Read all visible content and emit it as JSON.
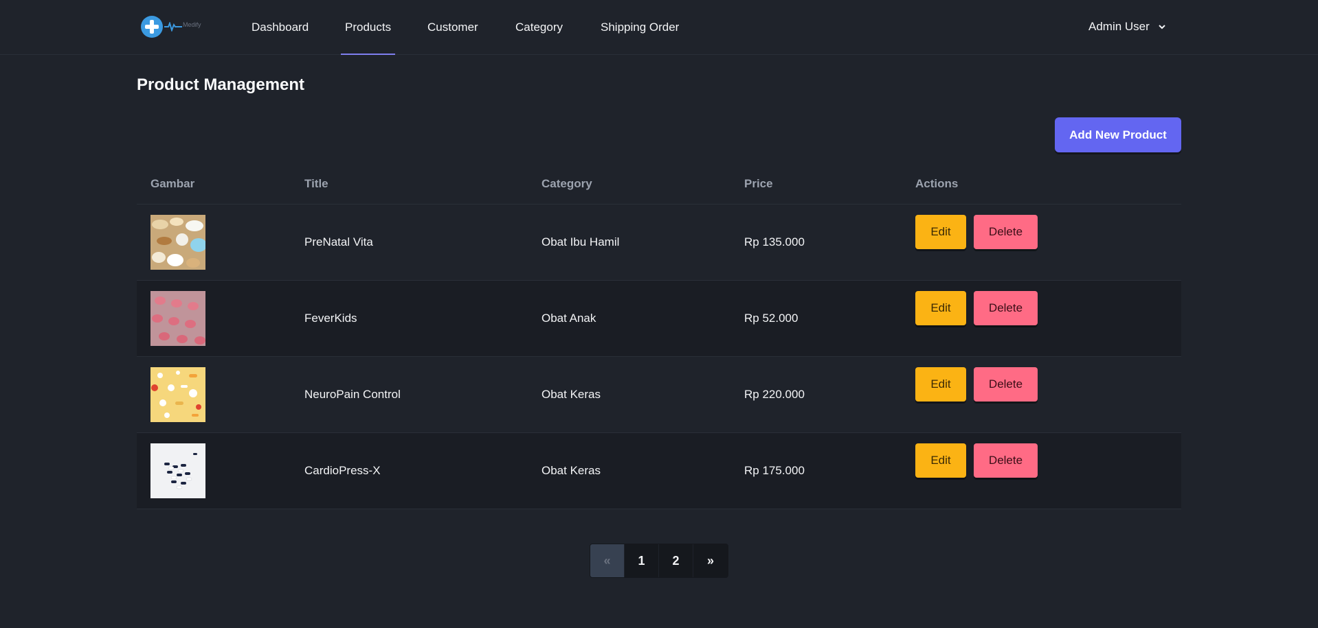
{
  "brand": {
    "logo_text": "Medify"
  },
  "nav": {
    "items": [
      {
        "label": "Dashboard",
        "active": false
      },
      {
        "label": "Products",
        "active": true
      },
      {
        "label": "Customer",
        "active": false
      },
      {
        "label": "Category",
        "active": false
      },
      {
        "label": "Shipping Order",
        "active": false
      }
    ],
    "user": "Admin User"
  },
  "page": {
    "title": "Product Management",
    "add_button": "Add New Product"
  },
  "table": {
    "headers": [
      "Gambar",
      "Title",
      "Category",
      "Price",
      "Actions"
    ],
    "rows": [
      {
        "image": "assorted-pills-photo",
        "title": "PreNatal Vita",
        "category": "Obat Ibu Hamil",
        "price": "Rp 135.000"
      },
      {
        "image": "pink-tablets-photo",
        "title": "FeverKids",
        "category": "Obat Anak",
        "price": "Rp 52.000"
      },
      {
        "image": "pills-yellow-background-photo",
        "title": "NeuroPain Control",
        "category": "Obat Keras",
        "price": "Rp 220.000"
      },
      {
        "image": "capsules-white-background-photo",
        "title": "CardioPress-X",
        "category": "Obat Keras",
        "price": "Rp 175.000"
      }
    ],
    "edit_label": "Edit",
    "delete_label": "Delete"
  },
  "pagination": {
    "prev": "«",
    "pages": [
      "1",
      "2"
    ],
    "next": "»"
  },
  "colors": {
    "background": "#1f232b",
    "accent": "#6366f1",
    "edit": "#fbb314",
    "delete": "#ff6b85"
  }
}
